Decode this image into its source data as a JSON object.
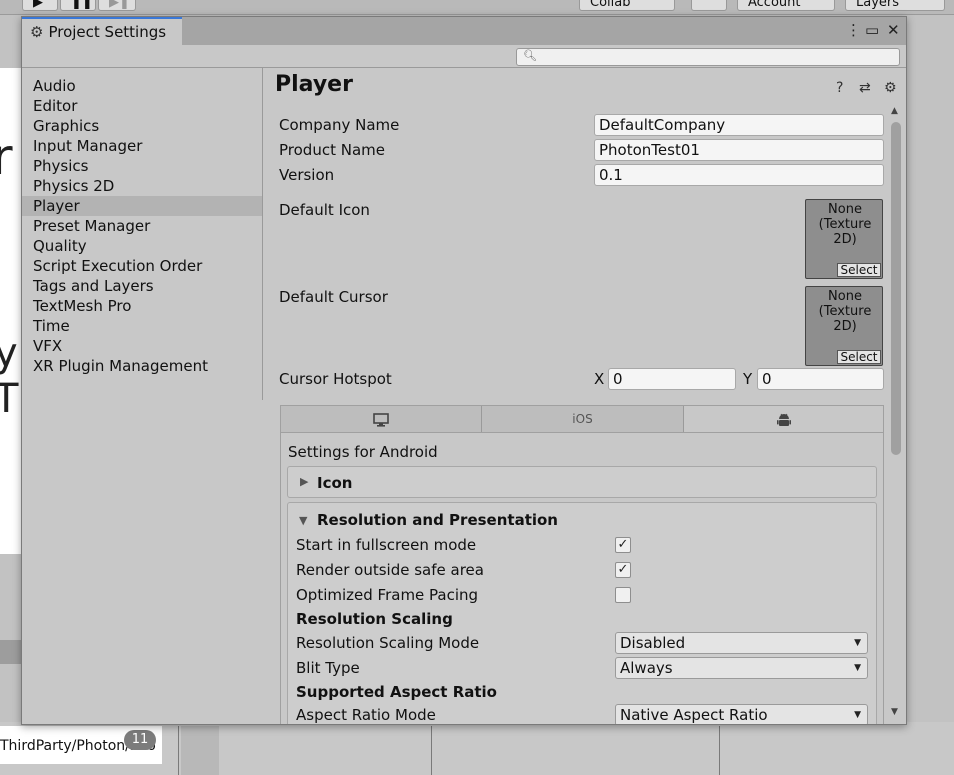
{
  "background": {
    "toolbar": {
      "collab": "Collab",
      "account": "Account",
      "layers": "Layers"
    },
    "big_text_1": "r",
    "big_text_2": "y T",
    "badge": "11",
    "path_text": "ThirdParty/Photon/Pho"
  },
  "window": {
    "title": "Project Settings",
    "search": {
      "placeholder": ""
    }
  },
  "sidebar": {
    "items": [
      {
        "label": "Audio"
      },
      {
        "label": "Editor"
      },
      {
        "label": "Graphics"
      },
      {
        "label": "Input Manager"
      },
      {
        "label": "Physics"
      },
      {
        "label": "Physics 2D"
      },
      {
        "label": "Player",
        "selected": true
      },
      {
        "label": "Preset Manager"
      },
      {
        "label": "Quality"
      },
      {
        "label": "Script Execution Order"
      },
      {
        "label": "Tags and Layers"
      },
      {
        "label": "TextMesh Pro"
      },
      {
        "label": "Time"
      },
      {
        "label": "VFX"
      },
      {
        "label": "XR Plugin Management"
      }
    ]
  },
  "player": {
    "title": "Player",
    "company_name": {
      "label": "Company Name",
      "value": "DefaultCompany"
    },
    "product_name": {
      "label": "Product Name",
      "value": "PhotonTest01"
    },
    "version": {
      "label": "Version",
      "value": "0.1"
    },
    "default_icon": {
      "label": "Default Icon",
      "none_text": "None\n(Texture 2D)",
      "select": "Select"
    },
    "default_cursor": {
      "label": "Default Cursor",
      "none_text": "None\n(Texture 2D)",
      "select": "Select"
    },
    "cursor_hotspot": {
      "label": "Cursor Hotspot",
      "x_label": "X",
      "x_value": "0",
      "y_label": "Y",
      "y_value": "0"
    },
    "platforms": {
      "standalone_icon": "monitor-icon",
      "ios": "iOS",
      "android_icon": "android-icon",
      "active": "android"
    },
    "settings_for": "Settings for Android",
    "icon_section": "Icon",
    "resolution_section": "Resolution and Presentation",
    "start_fullscreen": {
      "label": "Start in fullscreen mode",
      "checked": true,
      "mark": "✓"
    },
    "render_safe_area": {
      "label": "Render outside safe area",
      "checked": true,
      "mark": "✓"
    },
    "optimized_pacing": {
      "label": "Optimized Frame Pacing",
      "checked": false,
      "mark": ""
    },
    "resolution_scaling_header": "Resolution Scaling",
    "resolution_scaling_mode": {
      "label": "Resolution Scaling Mode",
      "value": "Disabled"
    },
    "blit_type": {
      "label": "Blit Type",
      "value": "Always"
    },
    "aspect_header": "Supported Aspect Ratio",
    "aspect_mode": {
      "label": "Aspect Ratio Mode",
      "value": "Native Aspect Ratio"
    }
  },
  "colors": {
    "accent": "#3a78d8",
    "selection": "#b3b3b3",
    "window_bg": "#c8c8c8"
  }
}
